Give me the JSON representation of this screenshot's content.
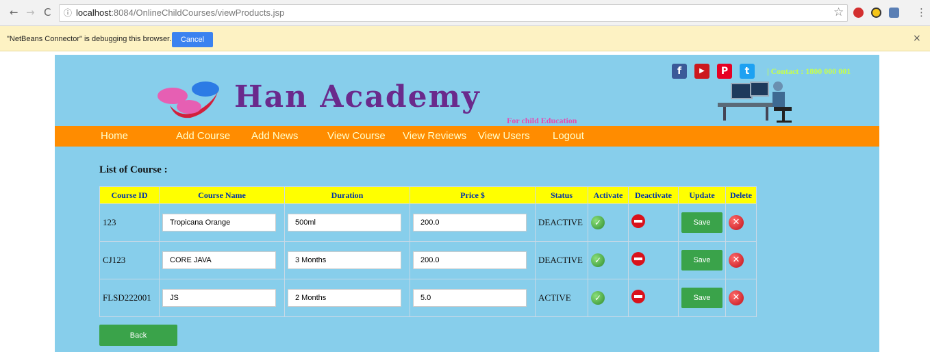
{
  "browser": {
    "back_glyph": "←",
    "forward_glyph": "→",
    "reload_glyph": "C",
    "info_glyph": "ⓘ",
    "url_host": "localhost",
    "url_path": ":8084/OnlineChildCourses/viewProducts.jsp",
    "star_glyph": "☆",
    "menu_glyph": "⋮",
    "debug_message": "\"NetBeans Connector\" is debugging this browser.",
    "cancel_label": "Cancel",
    "close_glyph": "×"
  },
  "header": {
    "social": [
      {
        "icon": "facebook-icon",
        "glyph": "f",
        "color": "#3b5998"
      },
      {
        "icon": "youtube-icon",
        "glyph": "▶",
        "color": "#cc181e"
      },
      {
        "icon": "pinterest-icon",
        "glyph": "P",
        "color": "#e60023"
      },
      {
        "icon": "twitter-icon",
        "glyph": "t",
        "color": "#1da1f2"
      }
    ],
    "contact": "| Contact : 1800 000 001",
    "brand": "Han Academy",
    "tagline": "For child Education"
  },
  "menu": [
    {
      "label": "Home"
    },
    {
      "label": "Add Course"
    },
    {
      "label": "Add News"
    },
    {
      "label": "View Course"
    },
    {
      "label": "View Reviews"
    },
    {
      "label": "View Users"
    },
    {
      "label": "Logout"
    }
  ],
  "list_title": "List of Course :",
  "table": {
    "headers": [
      "Course ID",
      "Course Name",
      "Duration",
      "Price $",
      "Status",
      "Activate",
      "Deactivate",
      "Update",
      "Delete"
    ],
    "rows": [
      {
        "id": "123",
        "name": "Tropicana Orange",
        "duration": "500ml",
        "price": "200.0",
        "status": "DEACTIVE"
      },
      {
        "id": "CJ123",
        "name": "CORE JAVA",
        "duration": "3 Months",
        "price": "200.0",
        "status": "DEACTIVE"
      },
      {
        "id": "FLSD222001",
        "name": "JS",
        "duration": "2 Months",
        "price": "5.0",
        "status": "ACTIVE"
      }
    ],
    "save_label": "Save",
    "activate_glyph": "✓",
    "delete_glyph": "✕"
  },
  "back_label": "Back",
  "colors": {
    "header_bg": "#87ceeb",
    "menu_bg": "#ff8c00",
    "table_header_bg": "#ffff00",
    "button_green": "#3aa34a",
    "brand_purple": "#6a2a8c",
    "tagline_pink": "#e04fb3"
  }
}
